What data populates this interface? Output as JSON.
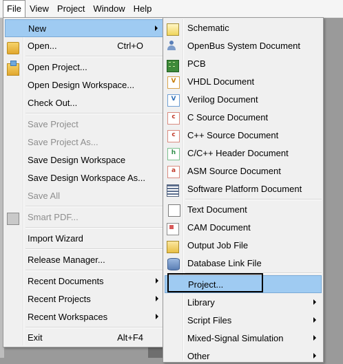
{
  "menubar": {
    "items": [
      "File",
      "View",
      "Project",
      "Window",
      "Help"
    ]
  },
  "file_menu": {
    "new": "New",
    "open": "Open...",
    "open_shortcut": "Ctrl+O",
    "open_project": "Open Project...",
    "open_design_workspace": "Open Design Workspace...",
    "check_out": "Check Out...",
    "save_project": "Save Project",
    "save_project_as": "Save Project As...",
    "save_design_workspace": "Save Design Workspace",
    "save_design_workspace_as": "Save Design Workspace As...",
    "save_all": "Save All",
    "smart_pdf": "Smart PDF...",
    "import_wizard": "Import Wizard",
    "release_manager": "Release Manager...",
    "recent_documents": "Recent Documents",
    "recent_projects": "Recent Projects",
    "recent_workspaces": "Recent Workspaces",
    "exit": "Exit",
    "exit_shortcut": "Alt+F4"
  },
  "new_submenu": {
    "schematic": "Schematic",
    "openbus": "OpenBus System Document",
    "pcb": "PCB",
    "vhdl": "VHDL Document",
    "verilog": "Verilog Document",
    "c_source": "C Source Document",
    "cpp_source": "C++ Source Document",
    "c_header": "C/C++ Header Document",
    "asm_source": "ASM Source Document",
    "software_platform": "Software Platform Document",
    "text": "Text Document",
    "cam": "CAM Document",
    "output_job": "Output Job File",
    "database_link": "Database Link File",
    "project": "Project...",
    "library": "Library",
    "script_files": "Script Files",
    "mixed_signal": "Mixed-Signal Simulation",
    "other": "Other"
  },
  "icon_letters": {
    "vhdl": "V",
    "verilog": "V",
    "c": "c",
    "cpp": "c",
    "header": "h",
    "asm": "a"
  }
}
